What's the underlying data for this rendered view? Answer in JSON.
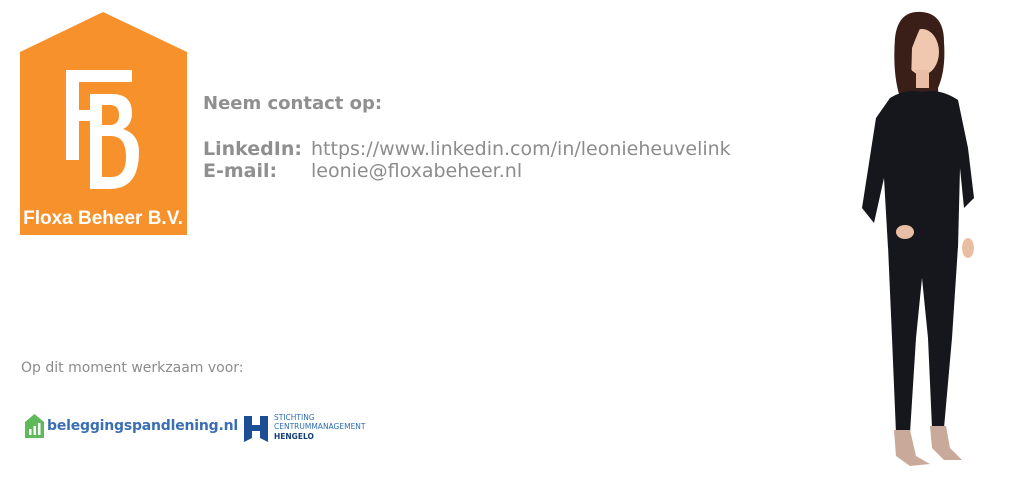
{
  "logo": {
    "text": "Floxa Beheer B.V.",
    "color": "#f7912b"
  },
  "contact": {
    "title": "Neem contact op:",
    "linkedin_label": "LinkedIn:",
    "linkedin_value": "https://www.linkedin.com/in/leonieheuvelink",
    "email_label": "E-mail:",
    "email_value": "leonie@floxabeheer.nl"
  },
  "work": {
    "label": "Op dit moment werkzaam voor:",
    "partners": [
      {
        "name": "beleggingspandlening.nl"
      },
      {
        "line1": "STICHTING",
        "line2": "CENTRUMMANAGEMENT",
        "line3": "HENGELO"
      }
    ]
  }
}
